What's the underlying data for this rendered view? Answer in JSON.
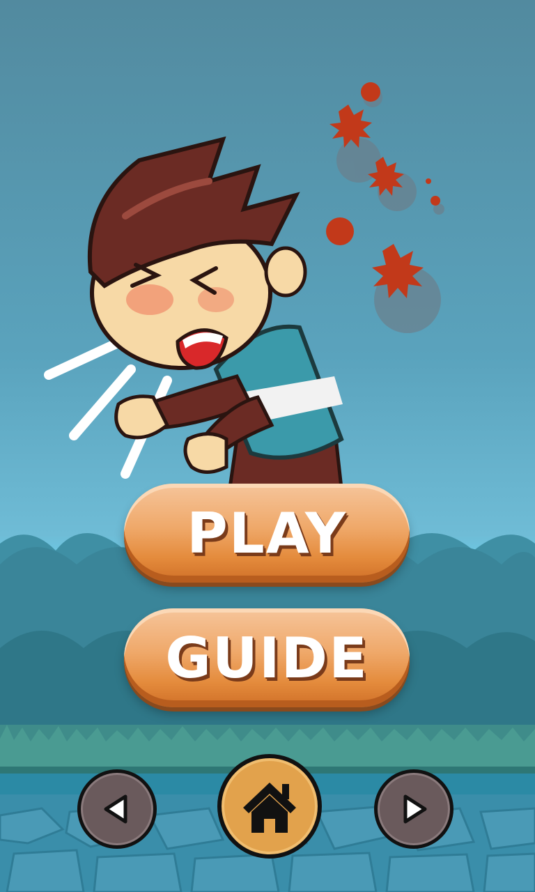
{
  "menu": {
    "play_label": "PLAY",
    "guide_label": "GUIDE"
  },
  "nav": {
    "prev_icon": "triangle-left-icon",
    "home_icon": "home-icon",
    "next_icon": "triangle-right-icon"
  },
  "colors": {
    "button_orange": "#efa869",
    "button_text_shadow": "#7a3b1a",
    "home_button": "#e2a24c",
    "nav_button_gray": "#6a5a5c",
    "splat_red": "#c2391a"
  },
  "illustration": {
    "subject": "sneezing-boy",
    "splat_icon": "germ-splat-icon"
  }
}
